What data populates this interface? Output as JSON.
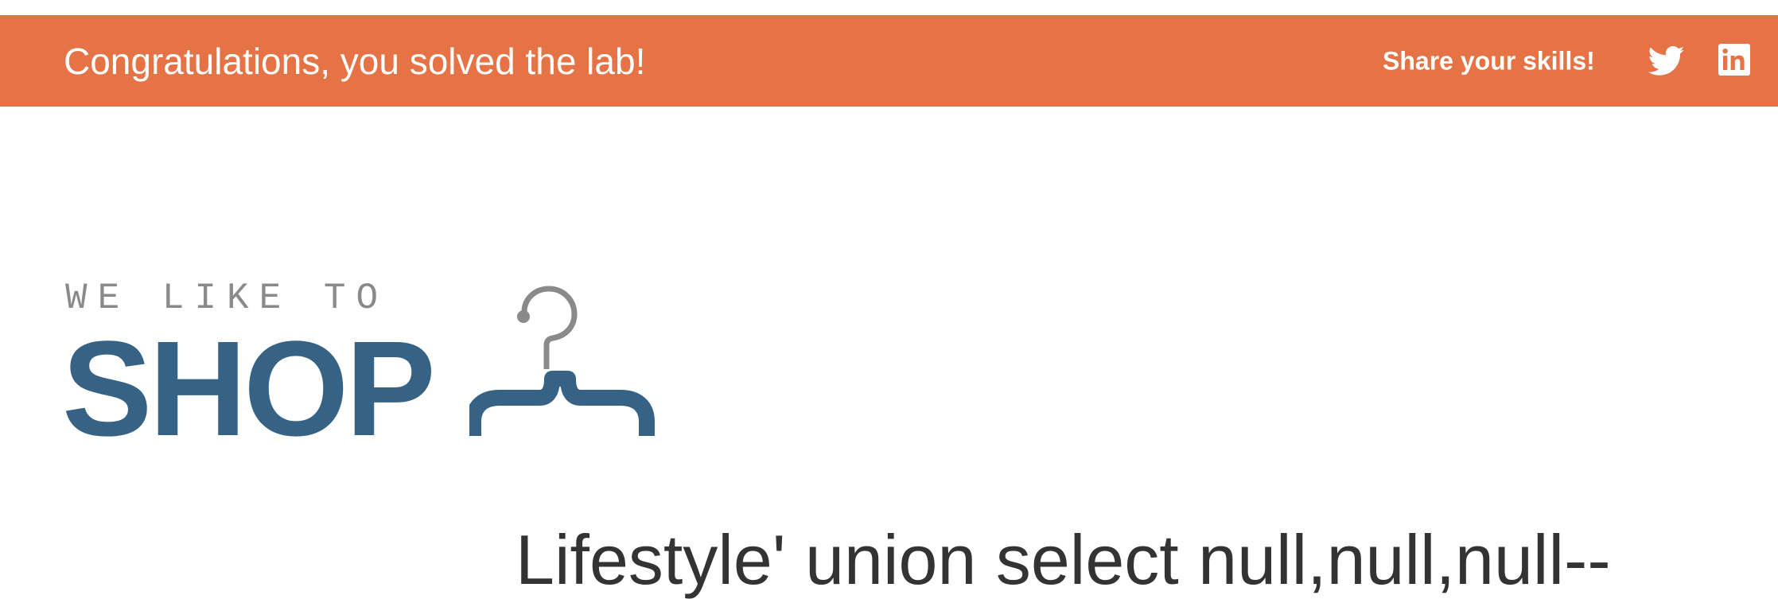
{
  "banner": {
    "title": "Congratulations, you solved the lab!",
    "share_label": "Share your skills!",
    "background_color": "#e57346",
    "twitter_icon": "twitter-icon",
    "linkedin_icon": "linkedin-icon"
  },
  "logo": {
    "tagline": "WE LIKE TO",
    "word": "SHOP",
    "icon": "hanger-icon",
    "brand_color": "#366385",
    "secondary_color": "#8a8a8a"
  },
  "main": {
    "heading": "Lifestyle' union select null,null,null--"
  }
}
